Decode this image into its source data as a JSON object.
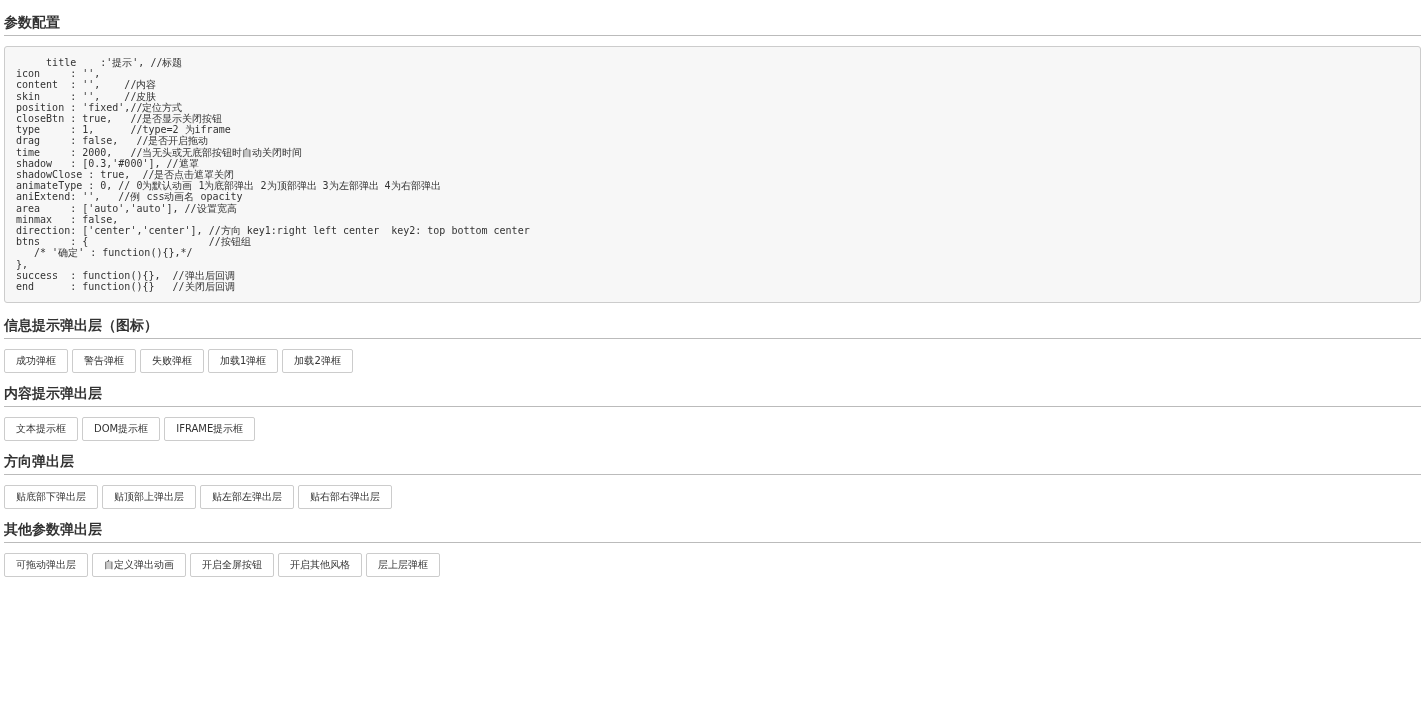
{
  "config": {
    "heading": "参数配置",
    "code_lines": [
      "     title    :'提示', //标题",
      "icon     : '',",
      "content  : '',    //内容",
      "skin     : '',    //皮肤",
      "position : 'fixed',//定位方式",
      "closeBtn : true,   //是否显示关闭按钮",
      "type     : 1,      //type=2 为iframe",
      "drag     : false,   //是否开启拖动",
      "time     : 2000,   //当无头或无底部按钮时自动关闭时间",
      "shadow   : [0.3,'#000'], //遮罩",
      "shadowClose : true,  //是否点击遮罩关闭",
      "animateType : 0, // 0为默认动画 1为底部弹出 2为顶部弹出 3为左部弹出 4为右部弹出",
      "aniExtend: '',   //例 css动画名 opacity",
      "area     : ['auto','auto'], //设置宽高",
      "minmax   : false,",
      "direction: ['center','center'], //方向 key1:right left center  key2: top bottom center",
      "btns     : {                    //按钮组",
      "   /* '确定' : function(){},*/",
      "},",
      "success  : function(){},  //弹出后回调",
      "end      : function(){}   //关闭后回调"
    ]
  },
  "sections": [
    {
      "heading": "信息提示弹出层（图标）",
      "buttons": [
        "成功弹框",
        "警告弹框",
        "失败弹框",
        "加载1弹框",
        "加载2弹框"
      ]
    },
    {
      "heading": "内容提示弹出层",
      "buttons": [
        "文本提示框",
        "DOM提示框",
        "IFRAME提示框"
      ]
    },
    {
      "heading": "方向弹出层",
      "buttons": [
        "贴底部下弹出层",
        "贴顶部上弹出层",
        "贴左部左弹出层",
        "贴右部右弹出层"
      ]
    },
    {
      "heading": "其他参数弹出层",
      "buttons": [
        "可拖动弹出层",
        "自定义弹出动画",
        "开启全屏按钮",
        "开启其他风格",
        "层上层弹框"
      ]
    }
  ]
}
